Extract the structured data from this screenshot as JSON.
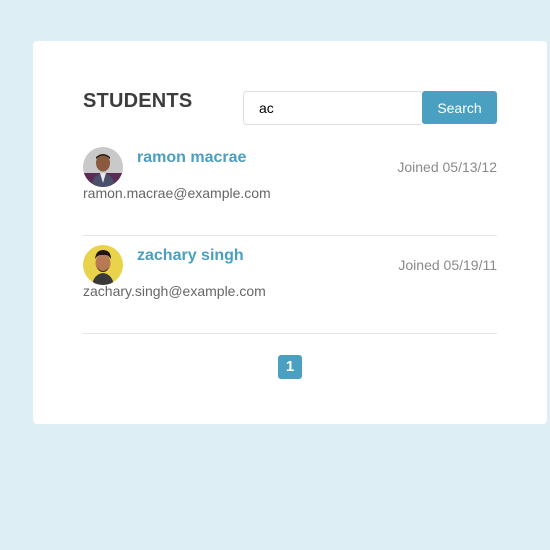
{
  "header": {
    "title": "STUDENTS"
  },
  "search": {
    "value": "ac",
    "button_label": "Search"
  },
  "students": [
    {
      "name": "ramon macrae",
      "email": "ramon.macrae@example.com",
      "joined": "Joined 05/13/12"
    },
    {
      "name": "zachary singh",
      "email": "zachary.singh@example.com",
      "joined": "Joined 05/19/11"
    }
  ],
  "pagination": {
    "current_page": "1"
  },
  "colors": {
    "background": "#ddeef4",
    "card": "#ffffff",
    "accent": "#4aa0c0",
    "title_text": "#3d3d3d",
    "muted_text": "#8a8a8a"
  }
}
